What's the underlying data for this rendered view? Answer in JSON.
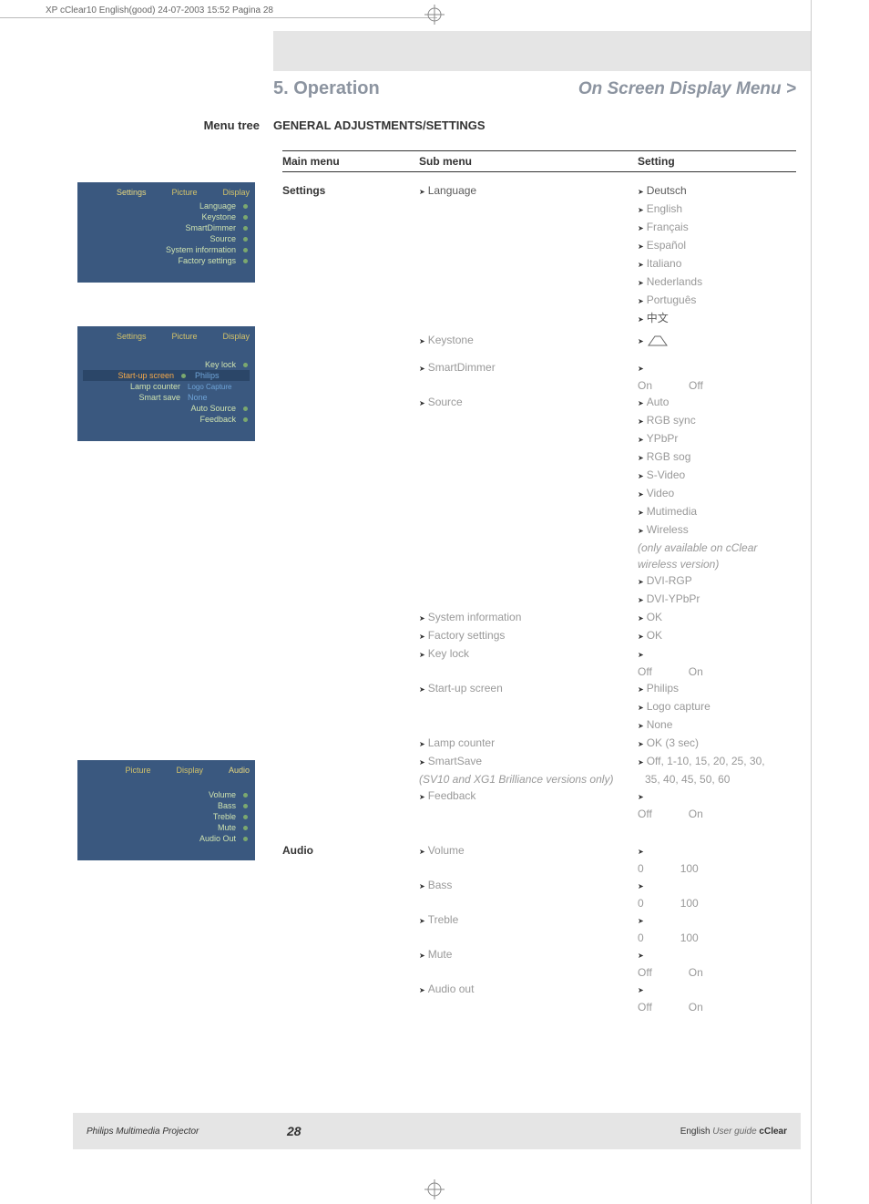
{
  "print_header": "XP cClear10 English(good)  24-07-2003  15:52  Pagina 28",
  "chapter": {
    "num": "5. Operation",
    "title": "On Screen Display Menu >"
  },
  "side_label": "Menu tree",
  "section_title": "GENERAL ADJUSTMENTS/SETTINGS",
  "cols": {
    "main": "Main menu",
    "sub": "Sub menu",
    "setting": "Setting"
  },
  "main1": "Settings",
  "main2": "Audio",
  "sub": {
    "language": "Language",
    "keystone": "Keystone",
    "smartdimmer": "SmartDimmer",
    "source": "Source",
    "sysinfo": "System information",
    "factory": "Factory settings",
    "keylock": "Key lock",
    "startup": "Start-up screen",
    "lamp": "Lamp counter",
    "smartsave": "SmartSave",
    "smartsave_note": "(SV10 and XG1 Brilliance versions only)",
    "feedback": "Feedback",
    "volume": "Volume",
    "bass": "Bass",
    "treble": "Treble",
    "mute": "Mute",
    "audioout": "Audio out"
  },
  "set": {
    "langs": [
      "Deutsch",
      "English",
      "Français",
      "Español",
      "Italiano",
      "Nederlands",
      "Português",
      "中文"
    ],
    "on": "On",
    "off": "Off",
    "sources": [
      "Auto",
      "RGB sync",
      "YPbPr",
      "RGB sog",
      "S-Video",
      "Video",
      "Mutimedia",
      "Wireless"
    ],
    "wireless_note1": "(only available on cClear",
    "wireless_note2": "wireless version)",
    "sources_tail": [
      "DVI-RGP",
      "DVI-YPbPr"
    ],
    "ok": "OK",
    "startup_opts": [
      "Philips",
      "Logo capture",
      "None"
    ],
    "lamp_ok": "OK (3 sec)",
    "smartsave_vals": "Off, 1-10, 15, 20, 25, 30,",
    "smartsave_vals2": "35, 40, 45, 50, 60",
    "zero": "0",
    "hundred": "100"
  },
  "footer": {
    "left": "Philips Multimedia Projector",
    "page": "28",
    "right_plain": "English ",
    "right_ital": "User guide  ",
    "right_bold": "cClear"
  },
  "ss1": {
    "tabs": [
      "Settings",
      "Picture",
      "Display"
    ],
    "rows": [
      "Language",
      "Keystone",
      "SmartDimmer",
      "Source",
      "System information",
      "Factory settings"
    ]
  },
  "ss2": {
    "tabs": [
      "Settings",
      "Picture",
      "Display"
    ],
    "rows": [
      "Key lock",
      "Start-up screen",
      "Lamp counter",
      "Smart save",
      "Auto Source",
      "Feedback"
    ],
    "opts": [
      "Philips",
      "Logo Capture",
      "None"
    ]
  },
  "ss3": {
    "tabs": [
      "Picture",
      "Display",
      "Audio"
    ],
    "rows": [
      "Volume",
      "Bass",
      "Treble",
      "Mute",
      "Audio Out"
    ]
  }
}
